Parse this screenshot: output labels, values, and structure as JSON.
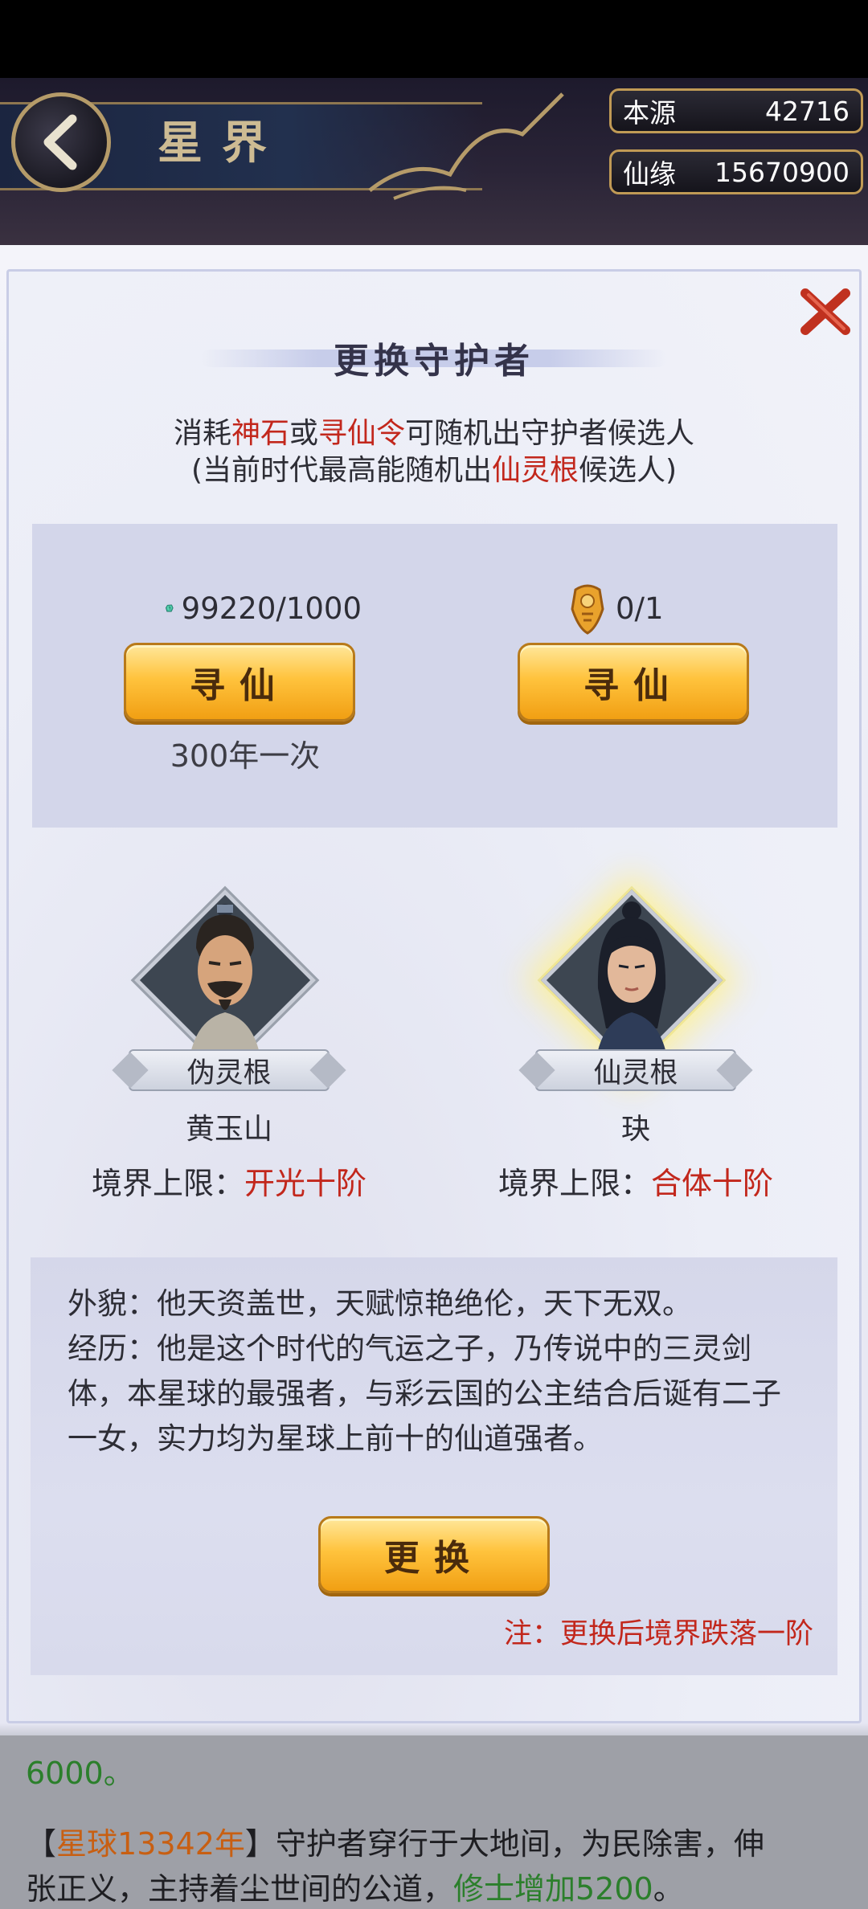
{
  "header": {
    "title": "星界",
    "resources": [
      {
        "label": "本源",
        "value": "42716"
      },
      {
        "label": "仙缘",
        "value": "15670900"
      }
    ]
  },
  "dialog": {
    "title": "更换守护者",
    "desc_line1": {
      "p1": "消耗",
      "r1": "神石",
      "p2": "或",
      "r2": "寻仙令",
      "p3": "可随机出守护者候选人"
    },
    "desc_line2": {
      "p1": "(当前时代最高能随机出",
      "r1": "仙灵根",
      "p2": "候选人)"
    },
    "costs": [
      {
        "icon": "green-gem-icon",
        "amount": "99220/1000",
        "button": "寻仙",
        "note": "300年一次"
      },
      {
        "icon": "gold-token-icon",
        "amount": "0/1",
        "button": "寻仙"
      }
    ],
    "candidates": [
      {
        "rank": "伪灵根",
        "name": "黄玉山",
        "realm_label": "境界上限：",
        "realm_value": "开光十阶"
      },
      {
        "rank": "仙灵根",
        "name": "玦",
        "realm_label": "境界上限：",
        "realm_value": "合体十阶"
      }
    ],
    "bio": {
      "appearance": "外貌：他天资盖世，天赋惊艳绝伦，天下无双。",
      "history": "经历：他是这个时代的气运之子，乃传说中的三灵剑体，本星球的最强者，与彩云国的公主结合后诞有二子一女，实力均为星球上前十的仙道强者。"
    },
    "replace_button": "更换",
    "warning": "注：更换后境界跌落一阶"
  },
  "log": {
    "line0_green": "6000。",
    "line1": {
      "bracket_open": "【",
      "year": "星球13342年",
      "bracket_close": "】",
      "text": "守护者穿行于大地间，为民除害，伸"
    },
    "line2": {
      "text": "张正义，主持着尘世间的公道，",
      "green": "修士增加5200",
      "end": "。"
    }
  },
  "colors": {
    "accent_red": "#c2271c",
    "gold_button": "#f7b52a",
    "panel": "#d3d6ea"
  }
}
